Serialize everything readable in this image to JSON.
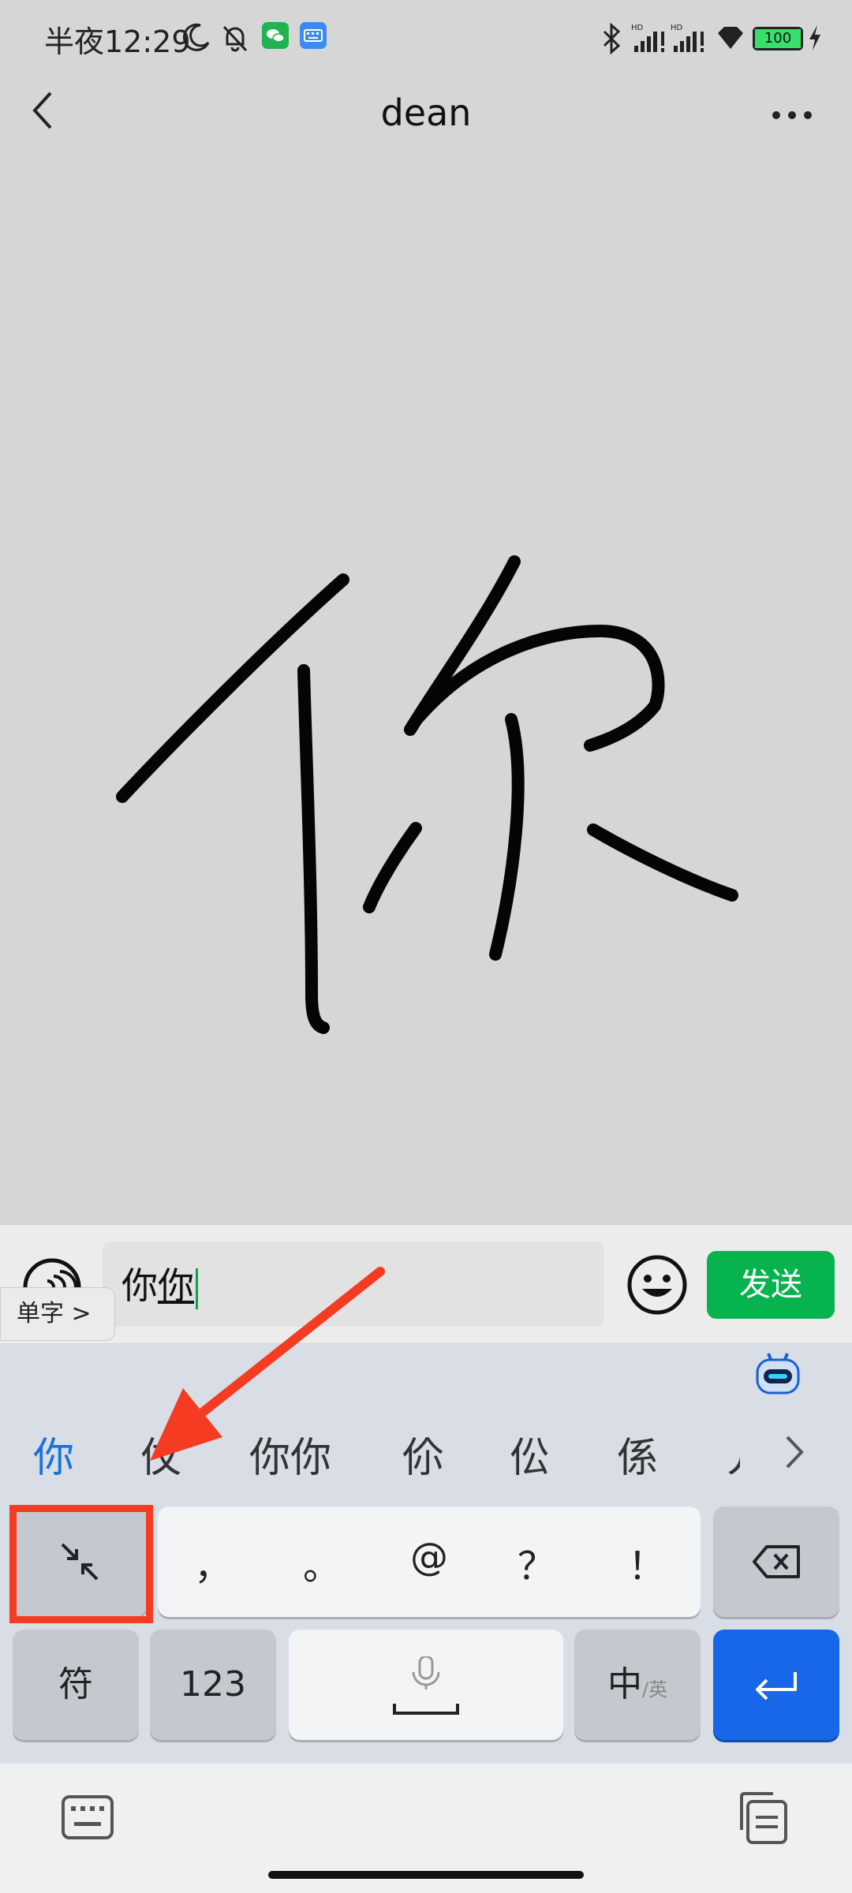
{
  "status": {
    "time": "半夜12:29",
    "battery": "100"
  },
  "nav": {
    "title": "dean"
  },
  "handwriting": {
    "character": "你"
  },
  "input": {
    "text_plain": "你",
    "text_composing": "你"
  },
  "send_label": "发送",
  "single_char_tab": "单字 >",
  "candidates": [
    "你",
    "伩",
    "你你",
    "伱",
    "伀",
    "係",
    "丿"
  ],
  "punct_keys": [
    "，",
    "。",
    "@",
    "？",
    "！"
  ],
  "bottom_keys": {
    "symbol": "符",
    "numbers": "123",
    "lang_main": "中",
    "lang_sub": "/英"
  },
  "colors": {
    "send": "#07b34e",
    "enter": "#1767e8",
    "candidate_active": "#1a73d9",
    "annotation": "#f53b22"
  }
}
